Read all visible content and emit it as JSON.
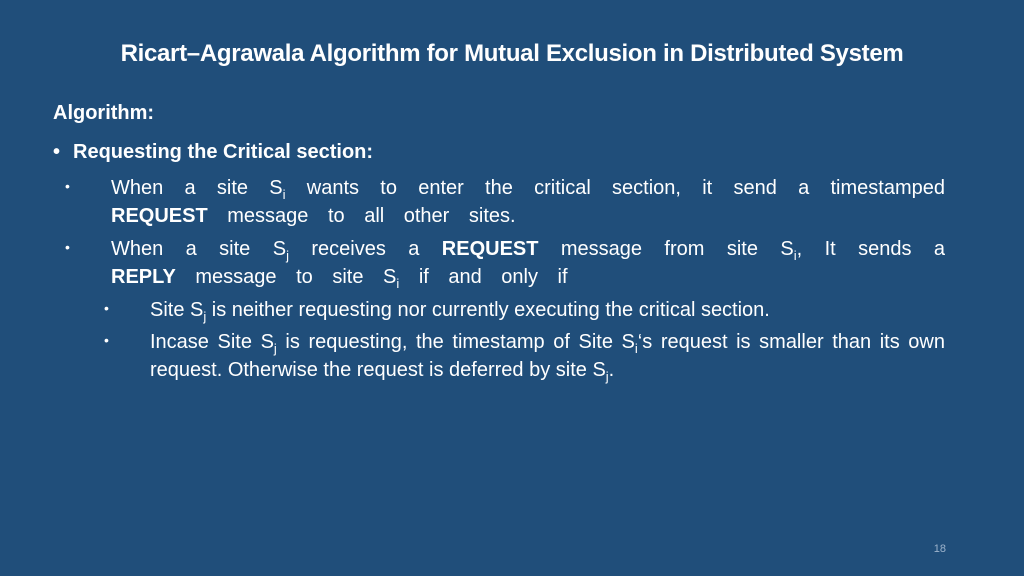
{
  "slide": {
    "title": "Ricart–Agrawala Algorithm for Mutual Exclusion in Distributed System",
    "heading": "Algorithm:",
    "section_label": "Requesting the Critical section:",
    "bullet_glyph": "•",
    "items": [
      {
        "parts": {
          "a": "When a site S",
          "a_sub": "i",
          "b": " wants to enter the critical section, it send a timestamped ",
          "bold": "REQUEST",
          "c": " message to all other sites."
        }
      },
      {
        "parts": {
          "a": "When a site S",
          "a_sub": "j",
          "b": " receives a ",
          "bold1": "REQUEST",
          "c": " message from site S",
          "c_sub": "i",
          "d": ", It sends a ",
          "bold2": "REPLY",
          "e": " message to site S",
          "e_sub": "i",
          "f": " if and only if"
        },
        "subitems": [
          {
            "a": "Site S",
            "a_sub": "j",
            "b": " is neither requesting nor currently executing the critical section."
          },
          {
            "a": "Incase Site S",
            "a_sub": "j",
            "b": " is requesting, the timestamp of Site S",
            "b_sub": "i",
            "c": "‘s request is smaller than its own request. Otherwise the request is deferred by site S",
            "c_sub": "j",
            "d": "."
          }
        ]
      }
    ],
    "page_number": "18"
  }
}
